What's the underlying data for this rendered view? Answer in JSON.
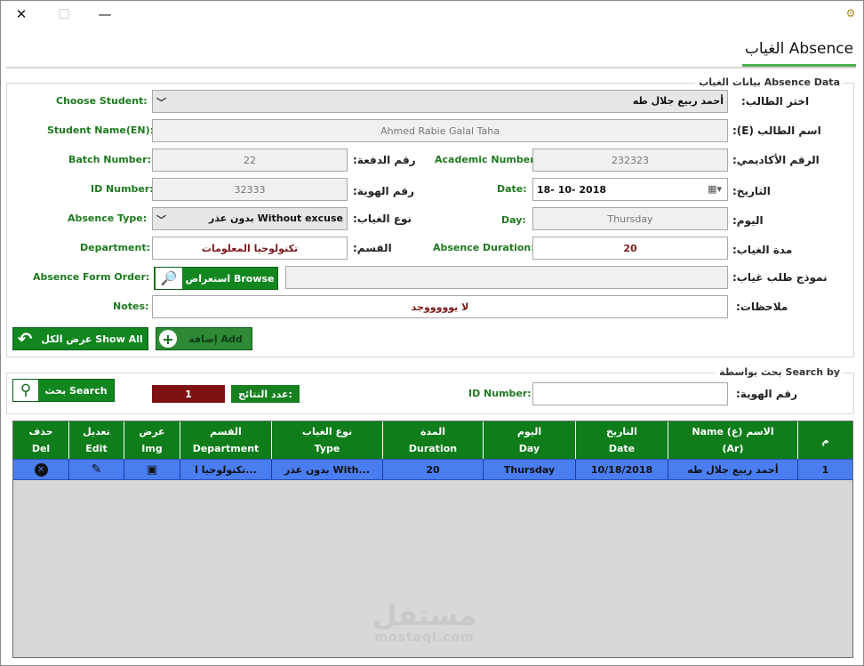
{
  "tab": {
    "label": "الغياب Absence"
  },
  "absence_group": {
    "title": "بيانات الغياب Absence Data"
  },
  "form": {
    "choose_student": {
      "label": "Choose Student:",
      "label_ar": "اختر الطالب:",
      "value": "أحمد ربيع جلال طه"
    },
    "student_name_en": {
      "label": "Student Name(EN):",
      "label_ar": "اسم الطالب (E):",
      "value": "Ahmed Rabie Galal Taha"
    },
    "batch_number": {
      "label": "Batch Number:",
      "label_ar": "رقم الدفعة:",
      "value": "22"
    },
    "academic_number": {
      "label": "Academic Number:",
      "label_ar": "الرقم الأكاديمي:",
      "value": "232323"
    },
    "id_number": {
      "label": "ID Number:",
      "label_ar": "رقم الهوية:",
      "value": "32333"
    },
    "date": {
      "label": "Date:",
      "label_ar": "التاريخ:",
      "value": "18- 10- 2018"
    },
    "absence_type": {
      "label": "Absence Type:",
      "label_ar": "نوع الغياب:",
      "value": "بدون عذر Without excuse"
    },
    "day": {
      "label": "Day:",
      "label_ar": "اليوم:",
      "value": "Thursday"
    },
    "department": {
      "label": "Department:",
      "label_ar": "القسم:",
      "value": "تكنولوجيا المعلومات"
    },
    "absence_duration": {
      "label": "Absence Duration:",
      "label_ar": "مدة الغياب:",
      "value": "20"
    },
    "absence_form_order": {
      "label": "Absence Form Order:",
      "label_ar": "نموذج طلب غياب:",
      "browse": "استعراض Browse",
      "value": ""
    },
    "notes": {
      "label": "Notes:",
      "label_ar": "ملاحظات:",
      "value": "لا يوووووجد"
    }
  },
  "buttons": {
    "show_all": "عرض الكل Show All",
    "add": "إضافة Add"
  },
  "search_group": {
    "title": "بحث بواسطة Search by",
    "search_button": "بحث Search",
    "results_count": "1",
    "results_label": "عدد النتائج:",
    "id_label": "ID Number:",
    "id_label_ar": "رقم الهوية:",
    "id_value": ""
  },
  "grid": {
    "columns": [
      {
        "key": "del",
        "ar": "حذف",
        "en": "Del"
      },
      {
        "key": "edit",
        "ar": "تعديل",
        "en": "Edit"
      },
      {
        "key": "img",
        "ar": "عرض",
        "en": "Img"
      },
      {
        "key": "department",
        "ar": "القسم",
        "en": "Department"
      },
      {
        "key": "type",
        "ar": "نوع الغياب",
        "en": "Type"
      },
      {
        "key": "duration",
        "ar": "المدة",
        "en": "Duration"
      },
      {
        "key": "day",
        "ar": "اليوم",
        "en": "Day"
      },
      {
        "key": "date",
        "ar": "التاريخ",
        "en": "Date"
      },
      {
        "key": "name",
        "ar": "Name (ع) الاسم",
        "en": "(Ar)"
      },
      {
        "key": "index",
        "ar": "م",
        "en": ""
      }
    ],
    "rows": [
      {
        "department": "تكنولوجيا ا...",
        "type": "بدون عذر With...",
        "duration": "20",
        "day": "Thursday",
        "date": "10/18/2018",
        "name": "أحمد ربيع جلال طه",
        "index": "1"
      }
    ]
  },
  "watermark": {
    "ar": "مستقل",
    "en": "mostaql.com"
  },
  "icons": [
    "close-icon",
    "maximize-icon",
    "minimize-icon",
    "app-icon",
    "chevron-down-icon",
    "calendar-icon",
    "folder-search-icon",
    "back-arrow-icon",
    "plus-circle-icon",
    "search-icon",
    "delete-icon",
    "edit-icon",
    "image-icon"
  ],
  "colors": {
    "accent_green": "#12861f",
    "tab_underline": "#4caf50",
    "selected_row": "#4a7ef0",
    "count_box": "#7e1212"
  }
}
